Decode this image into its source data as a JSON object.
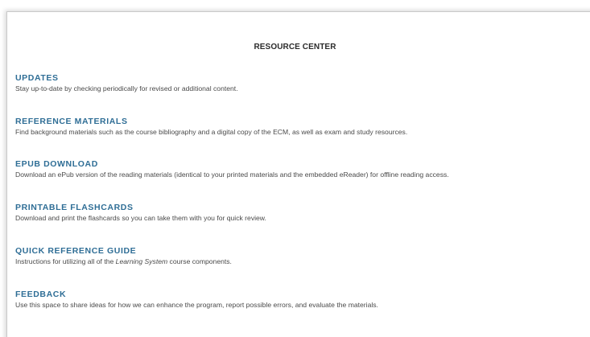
{
  "page_title": "RESOURCE CENTER",
  "sections": [
    {
      "title": "UPDATES",
      "description": "Stay up-to-date by checking periodically for revised or additional content."
    },
    {
      "title": "REFERENCE MATERIALS",
      "description": "Find background materials such as the course bibliography and a digital copy of the ECM, as well as exam and study resources."
    },
    {
      "title": "EPUB DOWNLOAD",
      "description": "Download an ePub version of the reading materials (identical to your printed materials and the embedded eReader) for offline reading access."
    },
    {
      "title": "PRINTABLE FLASHCARDS",
      "description": "Download and print the flashcards so you can take them with you for quick review."
    },
    {
      "title": "QUICK REFERENCE GUIDE",
      "description_before": "Instructions for utilizing all of the ",
      "description_emphasis": "Learning System",
      "description_after": " course components."
    },
    {
      "title": "FEEDBACK",
      "description": "Use this space to share ideas for how we can enhance the program, report possible errors, and evaluate the materials."
    }
  ],
  "colors": {
    "heading": "#2f6e96",
    "body_text": "#4a4a4a",
    "title_text": "#2b2b2b",
    "background": "#ffffff"
  }
}
